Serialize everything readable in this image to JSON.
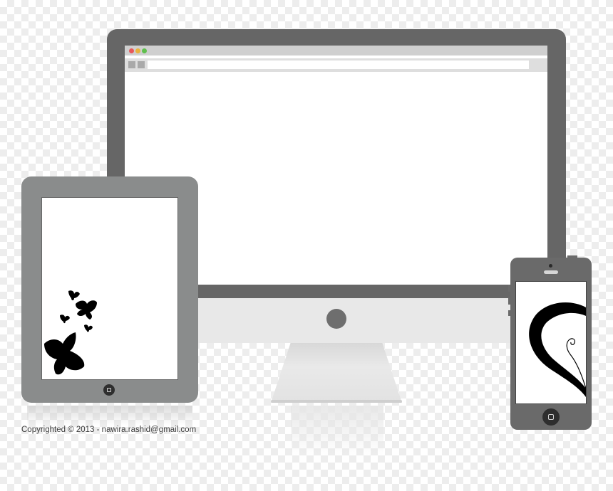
{
  "browser": {
    "traffic_lights": [
      {
        "name": "close",
        "color": "#e8585a"
      },
      {
        "name": "minimize",
        "color": "#e9b33c"
      },
      {
        "name": "maximize",
        "color": "#5fbf4d"
      }
    ]
  },
  "devices": {
    "monitor": {
      "icon": "desktop-monitor-icon"
    },
    "tablet": {
      "icon": "tablet-icon",
      "artwork": "butterflies-icon"
    },
    "phone": {
      "icon": "smartphone-icon",
      "artwork": "heart-swirl-icon"
    }
  },
  "footer": {
    "copyright": "Copyrighted © 2013 - nawira.rashid@gmail.com"
  },
  "colors": {
    "frame_dark": "#666666",
    "tablet_frame": "#8a8c8c",
    "screen": "#ffffff"
  }
}
